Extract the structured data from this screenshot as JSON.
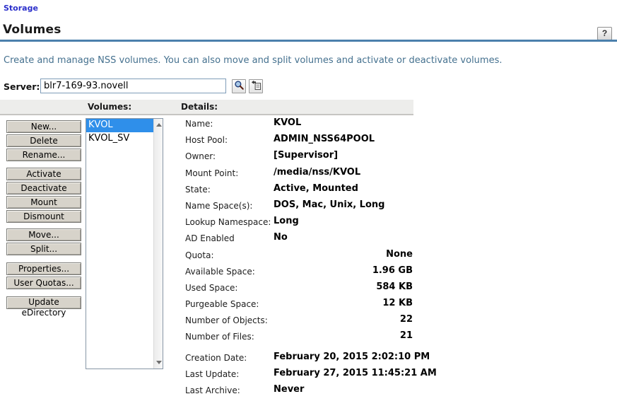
{
  "breadcrumb": {
    "label": "Storage"
  },
  "header": {
    "title": "Volumes",
    "help_label": "?"
  },
  "description": "Create and manage NSS volumes. You can also move and split volumes and activate or deactivate volumes.",
  "server": {
    "label": "Server:",
    "value": "blr7-169-93.novell",
    "icons": [
      "magnifier-icon",
      "object-history-icon"
    ]
  },
  "panels": {
    "volumes_label": "Volumes:",
    "details_label": "Details:"
  },
  "toolbar": {
    "buttons": [
      "New...",
      "Delete",
      "Rename...",
      "Activate",
      "Deactivate",
      "Mount",
      "Dismount",
      "Move...",
      "Split...",
      "Properties...",
      "User Quotas...",
      "Update eDirectory"
    ]
  },
  "volumes": {
    "items": [
      "KVOL",
      "KVOL_SV"
    ],
    "selected": "KVOL"
  },
  "details": {
    "rows": [
      {
        "label": "Name:",
        "value": "KVOL"
      },
      {
        "label": "Host Pool:",
        "value": "ADMIN_NSS64POOL"
      },
      {
        "label": "Owner:",
        "value": "[Supervisor]"
      },
      {
        "label": "Mount Point:",
        "value": "/media/nss/KVOL"
      },
      {
        "label": "State:",
        "value": "Active, Mounted"
      },
      {
        "label": "Name Space(s):",
        "value": "DOS, Mac, Unix, Long"
      },
      {
        "label": "Lookup Namespace:",
        "value": "Long"
      },
      {
        "label": "AD Enabled",
        "value": "No"
      },
      {
        "label": "Quota:",
        "value": "None"
      },
      {
        "label": "Available Space:",
        "value": "1.96 GB"
      },
      {
        "label": "Used Space:",
        "value": "584 KB"
      },
      {
        "label": "Purgeable Space:",
        "value": "12 KB"
      },
      {
        "label": "Number of Objects:",
        "value": "22"
      },
      {
        "label": "Number of Files:",
        "value": "21"
      },
      {
        "label": "Creation Date:",
        "value": "February 20, 2015 2:02:10 PM"
      },
      {
        "label": "Last Update:",
        "value": "February 27, 2015 11:45:21 AM"
      },
      {
        "label": "Last Archive:",
        "value": "Never"
      }
    ]
  },
  "colors": {
    "accent_rule": "#4b80ac",
    "link_blue": "#2b2fcb",
    "description_text": "#45718f",
    "selection_blue": "#2f8fea"
  }
}
